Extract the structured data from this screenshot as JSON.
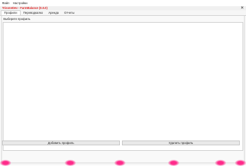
{
  "menu": {
    "items": [
      "Файл",
      "Настройки"
    ]
  },
  "window": {
    "title": "TrisoneDev - FarmBalance (0.0.0)",
    "close_glyph": "✕"
  },
  "tabs": [
    {
      "label": "Профили",
      "active": true
    },
    {
      "label": "Переводкалко",
      "active": false
    },
    {
      "label": "Аренда",
      "active": false
    },
    {
      "label": "Отчеты",
      "active": false
    }
  ],
  "profiles": {
    "prompt": "Выберите профиль",
    "items": [],
    "add_button_label": "Добавить профиль",
    "remove_button_label": "Удалить профиль"
  },
  "colors": {
    "title_red": "#e02828",
    "decoration_pink": "#ff2a8a"
  }
}
